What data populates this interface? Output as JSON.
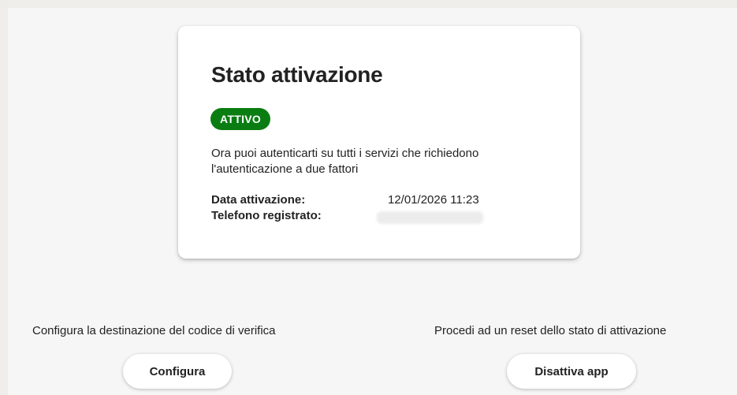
{
  "card": {
    "title": "Stato attivazione",
    "status_badge": "ATTIVO",
    "description": "Ora puoi autenticarti su tutti i servizi che richiedono l'autenticazione a due fattori",
    "fields": [
      {
        "label": "Data attivazione:",
        "value": "12/01/2026 11:23"
      },
      {
        "label": "Telefono registrato:",
        "value": ""
      }
    ]
  },
  "actions": {
    "configure": {
      "caption": "Configura la destinazione del codice di verifica",
      "button_label": "Configura"
    },
    "deactivate": {
      "caption": "Procedi ad un reset dello stato di attivazione",
      "button_label": "Disattiva app"
    }
  },
  "colors": {
    "badge_bg": "#0a7d12",
    "page_bg": "#f6f6f6"
  }
}
